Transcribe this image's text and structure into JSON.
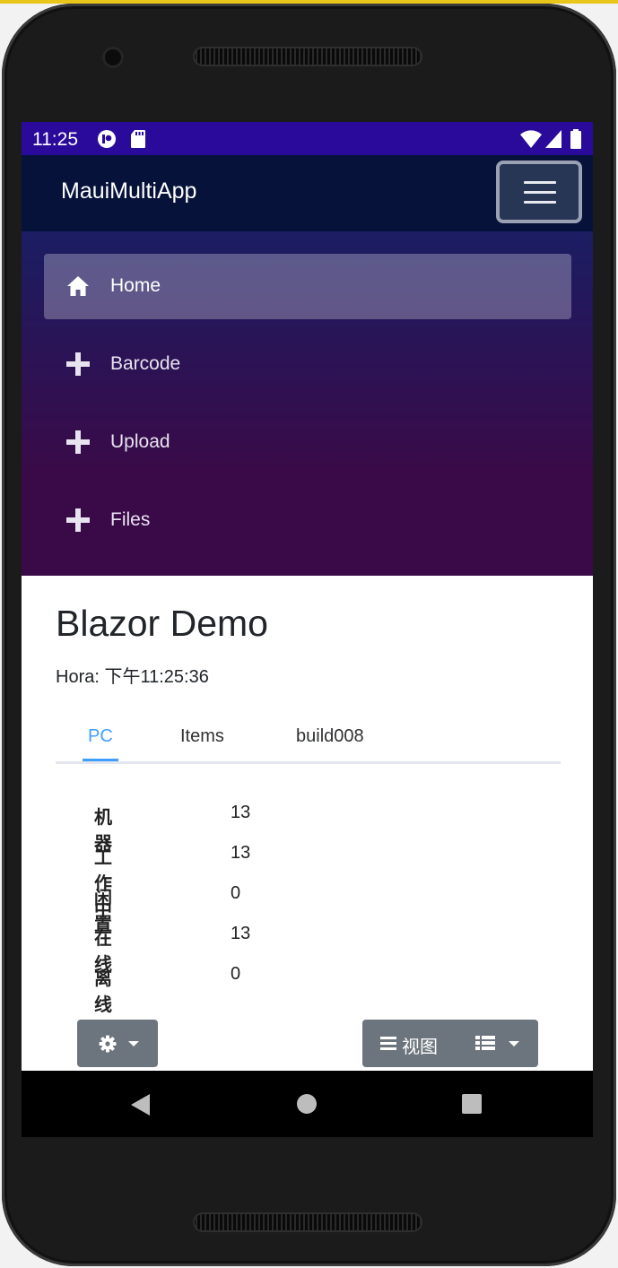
{
  "status_bar": {
    "time": "11:25",
    "icons": [
      "app-notification-icon",
      "sd-card-icon",
      "wifi-icon",
      "signal-icon",
      "battery-icon"
    ]
  },
  "header": {
    "brand": "MauiMultiApp",
    "menu_icon": "hamburger-icon"
  },
  "nav": {
    "items": [
      {
        "label": "Home",
        "icon": "home-icon",
        "active": true
      },
      {
        "label": "Barcode",
        "icon": "plus-icon",
        "active": false
      },
      {
        "label": "Upload",
        "icon": "plus-icon",
        "active": false
      },
      {
        "label": "Files",
        "icon": "plus-icon",
        "active": false
      }
    ]
  },
  "main": {
    "title": "Blazor Demo",
    "time_label": "Hora: 下午11:25:36",
    "tabs": [
      {
        "label": "PC",
        "active": true
      },
      {
        "label": "Items",
        "active": false
      },
      {
        "label": "build008",
        "active": false
      }
    ],
    "stats": [
      {
        "label": "机器",
        "value": "13"
      },
      {
        "label": "工作中",
        "value": "13"
      },
      {
        "label": "闲置",
        "value": "0"
      },
      {
        "label": "在线",
        "value": "13"
      },
      {
        "label": "离线",
        "value": "0"
      }
    ],
    "toolbar": {
      "settings_icon": "gear-icon",
      "view_label": "视图",
      "view_icon": "bars-icon",
      "list_icon": "list-icon"
    }
  },
  "android_nav": {
    "icons": [
      "back-icon",
      "home-circle-icon",
      "recents-icon"
    ]
  },
  "colors": {
    "status_bar": "#2a0a9a",
    "header": "#06123a",
    "nav_top": "#1b1d63",
    "nav_bottom": "#3a0a48",
    "tab_active": "#409eff",
    "button": "#6c757d"
  }
}
